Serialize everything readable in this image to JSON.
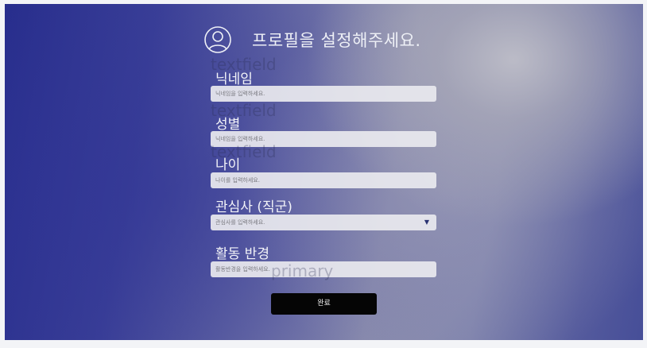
{
  "header": {
    "title": "프로필을 설정해주세요.",
    "icon": "user-profile-icon"
  },
  "overlay_labels": {
    "textfield_1": "textfield",
    "textfield_2": "textfield",
    "textfield_3": "textfield",
    "primary": "primary"
  },
  "form": {
    "nickname": {
      "label": "닉네임",
      "placeholder": "닉네임을 입력하세요."
    },
    "gender": {
      "label": "성별",
      "placeholder": "닉네임을 입력하세요."
    },
    "age": {
      "label": "나이",
      "placeholder": "나이를 입력하세요."
    },
    "interest": {
      "label": "관심사 (직군)",
      "placeholder": "관심사를 입력하세요.",
      "caret_icon": "triangle-down-icon"
    },
    "area": {
      "label": "활동 반경",
      "placeholder": "활동반경을 입력하세요."
    },
    "submit_label": "완료"
  },
  "colors": {
    "background_left": "#272d8c",
    "background_highlight": "#bebec8",
    "field_background": "#e8e8ee",
    "button_background": "#050505",
    "button_text": "#f0f0f0"
  }
}
